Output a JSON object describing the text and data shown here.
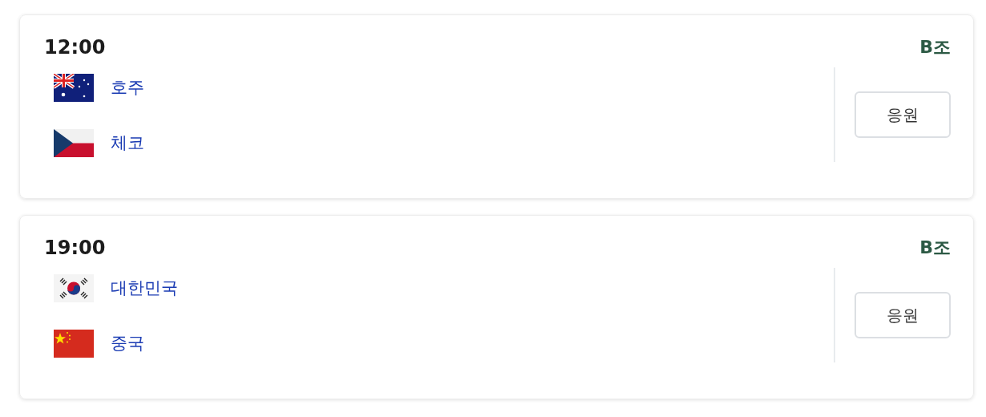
{
  "matches": [
    {
      "time": "12:00",
      "group": "B조",
      "teams": [
        {
          "name": "호주",
          "kind": "au"
        },
        {
          "name": "체코",
          "kind": "cz"
        }
      ],
      "button": "응원"
    },
    {
      "time": "19:00",
      "group": "B조",
      "teams": [
        {
          "name": "대한민국",
          "kind": "kr"
        },
        {
          "name": "중국",
          "kind": "cn"
        }
      ],
      "button": "응원"
    }
  ]
}
